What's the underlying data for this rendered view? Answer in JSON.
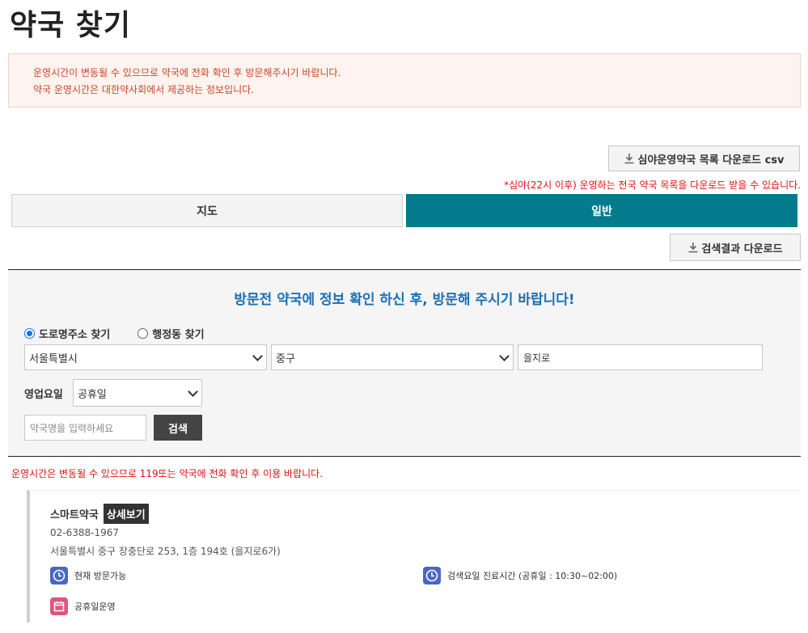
{
  "page": {
    "title": "약국 찾기"
  },
  "notice": {
    "line1": "운영시간이 변동될 수 있으므로 약국에 전화 확인 후 방문해주시기 바랍니다.",
    "line2": "약국 운영시간은 대한약사회에서 제공하는 정보입니다."
  },
  "csv": {
    "button_label": "심야운영약국 목록 다운로드 csv",
    "note": "*심야(22시 이후) 운영하는 전국 약국 목록을 다운로드 받을 수 있습니다."
  },
  "tabs": [
    {
      "label": "지도",
      "active": false
    },
    {
      "label": "일반",
      "active": true
    }
  ],
  "result_download": {
    "label": "검색결과 다운로드"
  },
  "search": {
    "heading": "방문전 약국에 정보 확인 하신 후, 방문해 주시기 바랍니다!",
    "radios": [
      {
        "label": "도로명주소 찾기",
        "checked": true
      },
      {
        "label": "행정동 찾기",
        "checked": false
      }
    ],
    "city": "서울특별시",
    "district": "중구",
    "road": "을지로",
    "day_label": "영업요일",
    "day_value": "공휴일",
    "name_placeholder": "약국명을 입력하세요",
    "search_button": "검색"
  },
  "warning": "운영시간은 변동될 수 있으므로 119또는 약국에 전화 확인 후 이용 바랍니다.",
  "result": {
    "name": "스마트약국",
    "detail_label": "상세보기",
    "phone": "02-6388-1967",
    "address": "서울특별시 중구 장충단로 253, 1층 194호 (을지로6가)",
    "status": "현재 방문가능",
    "hours": "검색요일 진료시간 (공휴일 : 10:30~02:00)",
    "holiday": "공휴일운영"
  },
  "colors": {
    "tab_active": "#047b8d",
    "heading": "#1c6fb3",
    "warning": "#dd1111",
    "clock_icon": "#4a66c6",
    "calendar_icon": "#e2547f"
  }
}
